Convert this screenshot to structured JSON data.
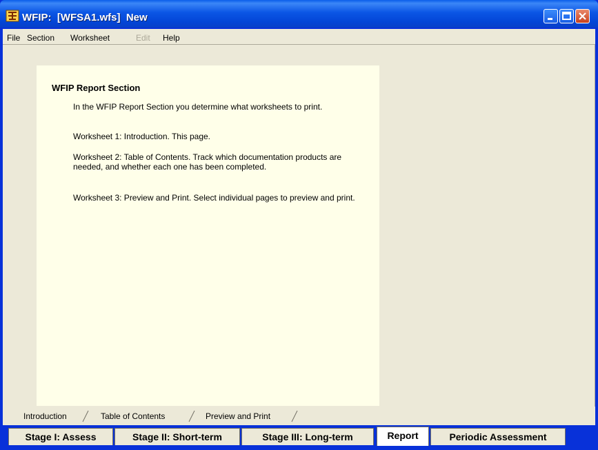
{
  "window": {
    "title": "WFIP:  [WFSA1.wfs]  New",
    "app_icon": "wfip-app-icon",
    "controls": [
      "minimize",
      "maximize",
      "close"
    ]
  },
  "menu": {
    "items": [
      {
        "label": "File",
        "enabled": true
      },
      {
        "label": "Section",
        "enabled": true
      },
      {
        "label": "Worksheet",
        "enabled": true
      },
      {
        "label": "Edit",
        "enabled": false
      },
      {
        "label": "Help",
        "enabled": true
      }
    ]
  },
  "content": {
    "heading": "WFIP Report Section",
    "paragraphs": [
      "In the WFIP Report Section you determine what worksheets to print.",
      "Worksheet 1: Introduction.  This page.",
      "Worksheet 2: Table of Contents.  Track which documentation products are needed, and whether each one has been completed.",
      "Worksheet 3: Preview and Print.  Select individual pages to preview and print."
    ]
  },
  "worksheet_tabs": [
    "Introduction",
    "Table of Contents",
    "Preview and Print"
  ],
  "stage_tabs": [
    {
      "label": "Stage I: Assess",
      "active": false
    },
    {
      "label": "Stage II: Short-term",
      "active": false
    },
    {
      "label": "Stage III: Long-term",
      "active": false
    },
    {
      "label": "Report",
      "active": true
    },
    {
      "label": "Periodic Assessment",
      "active": false
    }
  ],
  "colors": {
    "title_bar": "#0b56e5",
    "window_face": "#ece9d8",
    "paper": "#ffffe9",
    "active_tab": "#ffffff"
  }
}
